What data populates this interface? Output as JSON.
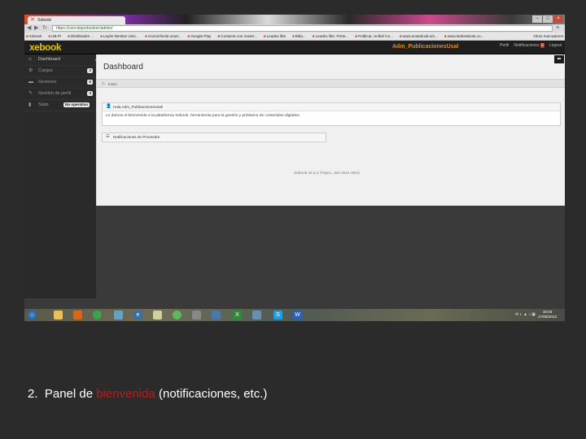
{
  "browser": {
    "tab_title": "Xebook",
    "url": "https://concdejeebooker/admin/",
    "window_controls": [
      "–",
      "□",
      "×"
    ],
    "bookmarks": [
      "Xebook",
      "UB.PI",
      "Distribuidor ...",
      "Leyler Benitez Univ...",
      "cicerochecki.unud...",
      "Google Play",
      "Contacta con nosotr...",
      "Leadex libri",
      "Bitla...",
      "Leadex libri. Porte...",
      "Publicar, Unibel Co...",
      "www.unwebook.s/o...",
      "www.leebeebook.co..."
    ],
    "bookmarks_other": "Otros marcadores"
  },
  "header": {
    "logo": "xebook",
    "app_name": "Adm_PublicacionesUsal",
    "user": "Perfil",
    "notifications": "Notificaciones",
    "notif_count": "0",
    "logout": "Logout"
  },
  "sidebar": {
    "items": [
      {
        "icon": "⌂",
        "label": "Dashboard",
        "badge": ""
      },
      {
        "icon": "⚙",
        "label": "Cargos",
        "badge": "2"
      },
      {
        "icon": "▬",
        "label": "Gestores",
        "badge": "6"
      },
      {
        "icon": "✎",
        "label": "Gestión de perfil",
        "badge": "3"
      },
      {
        "icon": "▮",
        "label": "Stats",
        "badge": "No operativo"
      }
    ]
  },
  "main": {
    "title": "Dashboard",
    "breadcrumb": "Inicio",
    "welcome_header": "Hola Adm_PublicacionesUsal!",
    "welcome_body": "Le damos el bienvenida a la plataforma Xebook, herramienta para la gestión y préstamo de contenidos digitales.",
    "notif_header": "Notificaciones de Proveedor",
    "footer": "Xebook v0.2.4 ©Xpro, Juis 2011-2013",
    "back_label": "⬅"
  },
  "taskbar": {
    "clock_time": "16:05",
    "clock_date": "17/05/2013",
    "icons": [
      "start",
      "folder",
      "firefox",
      "chrome",
      "app",
      "ie",
      "files",
      "spotify",
      "media",
      "network",
      "excel",
      "search",
      "skype",
      "word"
    ]
  },
  "caption": {
    "number": "2.",
    "prefix": "Panel de ",
    "highlight": "bienvenida",
    "suffix": " (notificaciones, etc.)"
  },
  "colors": {
    "highlight": "#b02020",
    "brand": "#e6c300",
    "app_name": "#e08a1e"
  }
}
